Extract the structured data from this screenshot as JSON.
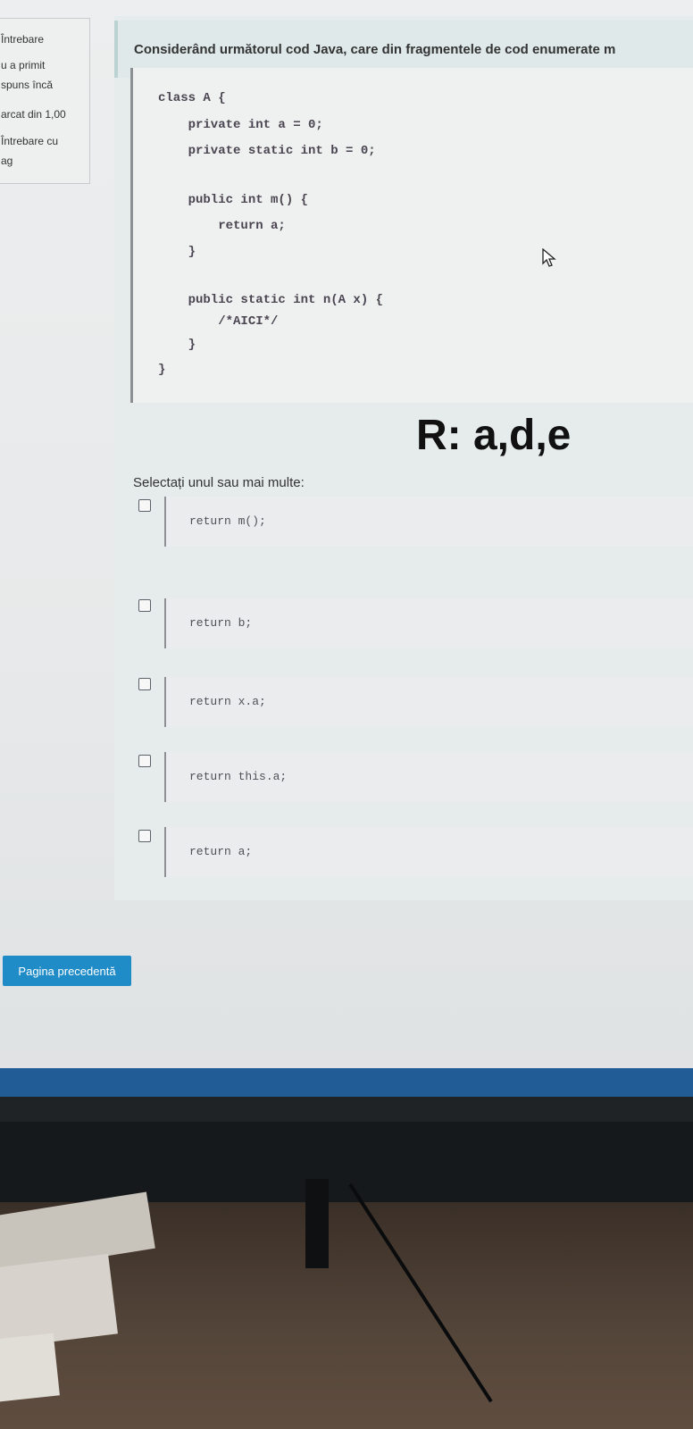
{
  "sidebar": {
    "lines": [
      "Întrebare",
      "u a primit",
      "spuns încă",
      "arcat din 1,00",
      "Întrebare cu",
      "ag"
    ]
  },
  "question": {
    "text": "Considerând următorul cod Java, care din fragmentele de cod enumerate m",
    "code_lines": [
      "class A {",
      "    private int a = 0;",
      "    private static int b = 0;",
      "",
      "    public int m() {",
      "        return a;",
      "    }",
      "",
      "    public static int n(A x) {",
      "        /*AICI*/",
      "    }",
      "}"
    ]
  },
  "answer_note": "R: a,d,e",
  "select_label": "Selectați unul sau mai multe:",
  "options": [
    {
      "code": "return m();",
      "checked": false
    },
    {
      "code": "return b;",
      "checked": false
    },
    {
      "code": "return x.a;",
      "checked": false
    },
    {
      "code": "return this.a;",
      "checked": false
    },
    {
      "code": "return a;",
      "checked": false
    }
  ],
  "nav": {
    "prev_label": "Pagina precedentă"
  },
  "colors": {
    "button": "#1f8bc7",
    "taskbar": "#215c96"
  },
  "taskbar_icons": [
    "windows-start-icon",
    "search-icon",
    "task-view-icon",
    "chat-icon",
    "file-explorer-icon"
  ],
  "cursor_icon": "mouse-pointer-icon"
}
